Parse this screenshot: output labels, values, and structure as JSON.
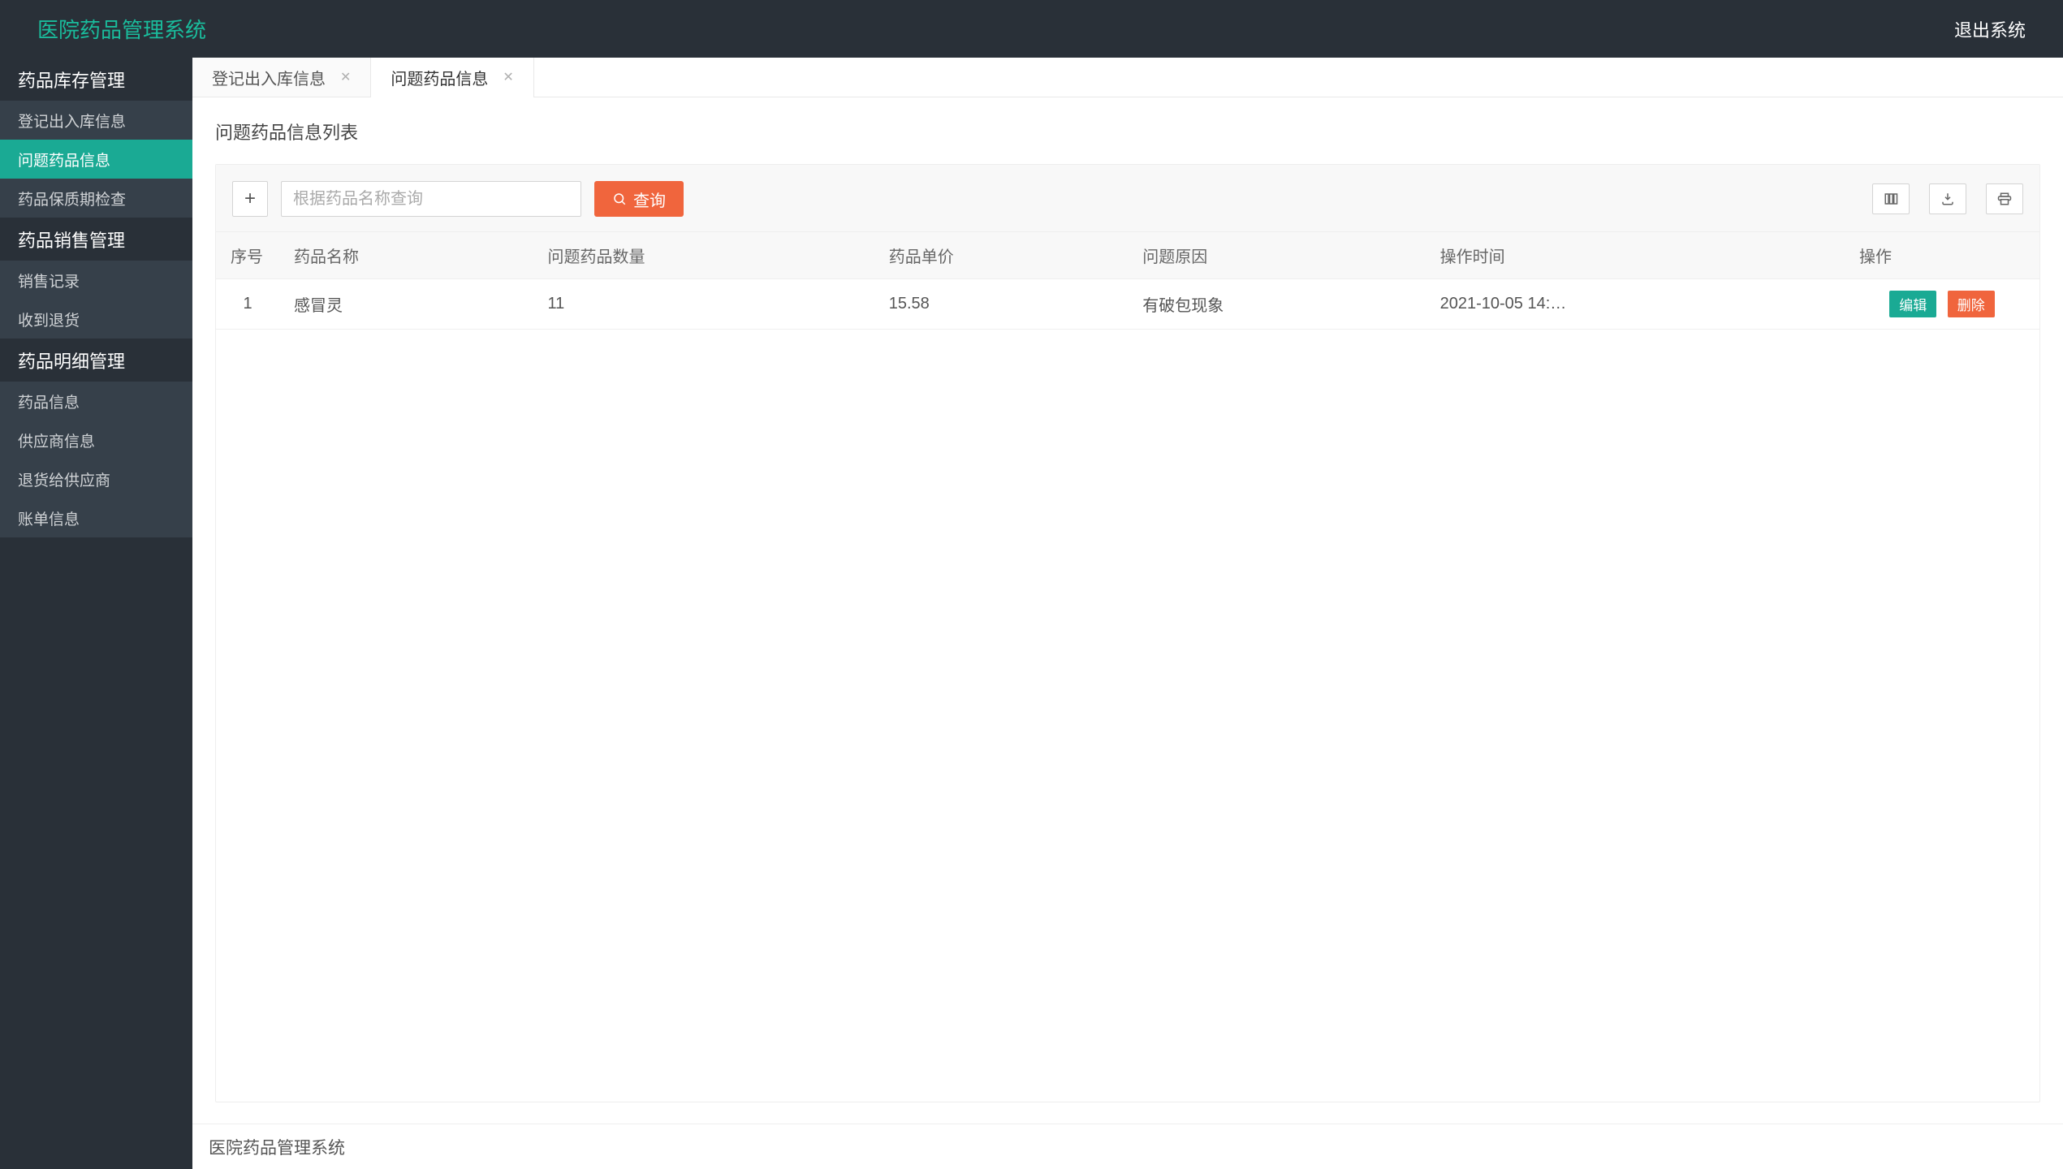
{
  "header": {
    "title": "医院药品管理系统",
    "logout": "退出系统"
  },
  "sidebar": {
    "groups": [
      {
        "label": "药品库存管理",
        "items": [
          {
            "label": "登记出入库信息",
            "active": false
          },
          {
            "label": "问题药品信息",
            "active": true
          },
          {
            "label": "药品保质期检查",
            "active": false
          }
        ]
      },
      {
        "label": "药品销售管理",
        "items": [
          {
            "label": "销售记录",
            "active": false
          },
          {
            "label": "收到退货",
            "active": false
          }
        ]
      },
      {
        "label": "药品明细管理",
        "items": [
          {
            "label": "药品信息",
            "active": false
          },
          {
            "label": "供应商信息",
            "active": false
          },
          {
            "label": "退货给供应商",
            "active": false
          },
          {
            "label": "账单信息",
            "active": false
          }
        ]
      }
    ]
  },
  "tabs": [
    {
      "label": "登记出入库信息",
      "active": false
    },
    {
      "label": "问题药品信息",
      "active": true
    }
  ],
  "content": {
    "title": "问题药品信息列表",
    "search_placeholder": "根据药品名称查询",
    "search_button": "查询",
    "columns": {
      "seq": "序号",
      "name": "药品名称",
      "qty": "问题药品数量",
      "price": "药品单价",
      "reason": "问题原因",
      "time": "操作时间",
      "actions": "操作"
    },
    "rows": [
      {
        "seq": "1",
        "name": "感冒灵",
        "qty": "11",
        "price": "15.58",
        "reason": "有破包现象",
        "time": "2021-10-05 14:…"
      }
    ],
    "action_labels": {
      "edit": "编辑",
      "delete": "删除"
    }
  },
  "footer": {
    "text": "医院药品管理系统"
  },
  "colors": {
    "accent": "#1aaa94",
    "primary_btn": "#f0653d",
    "header_bg": "#293038",
    "sidebar_bg": "#293038"
  }
}
